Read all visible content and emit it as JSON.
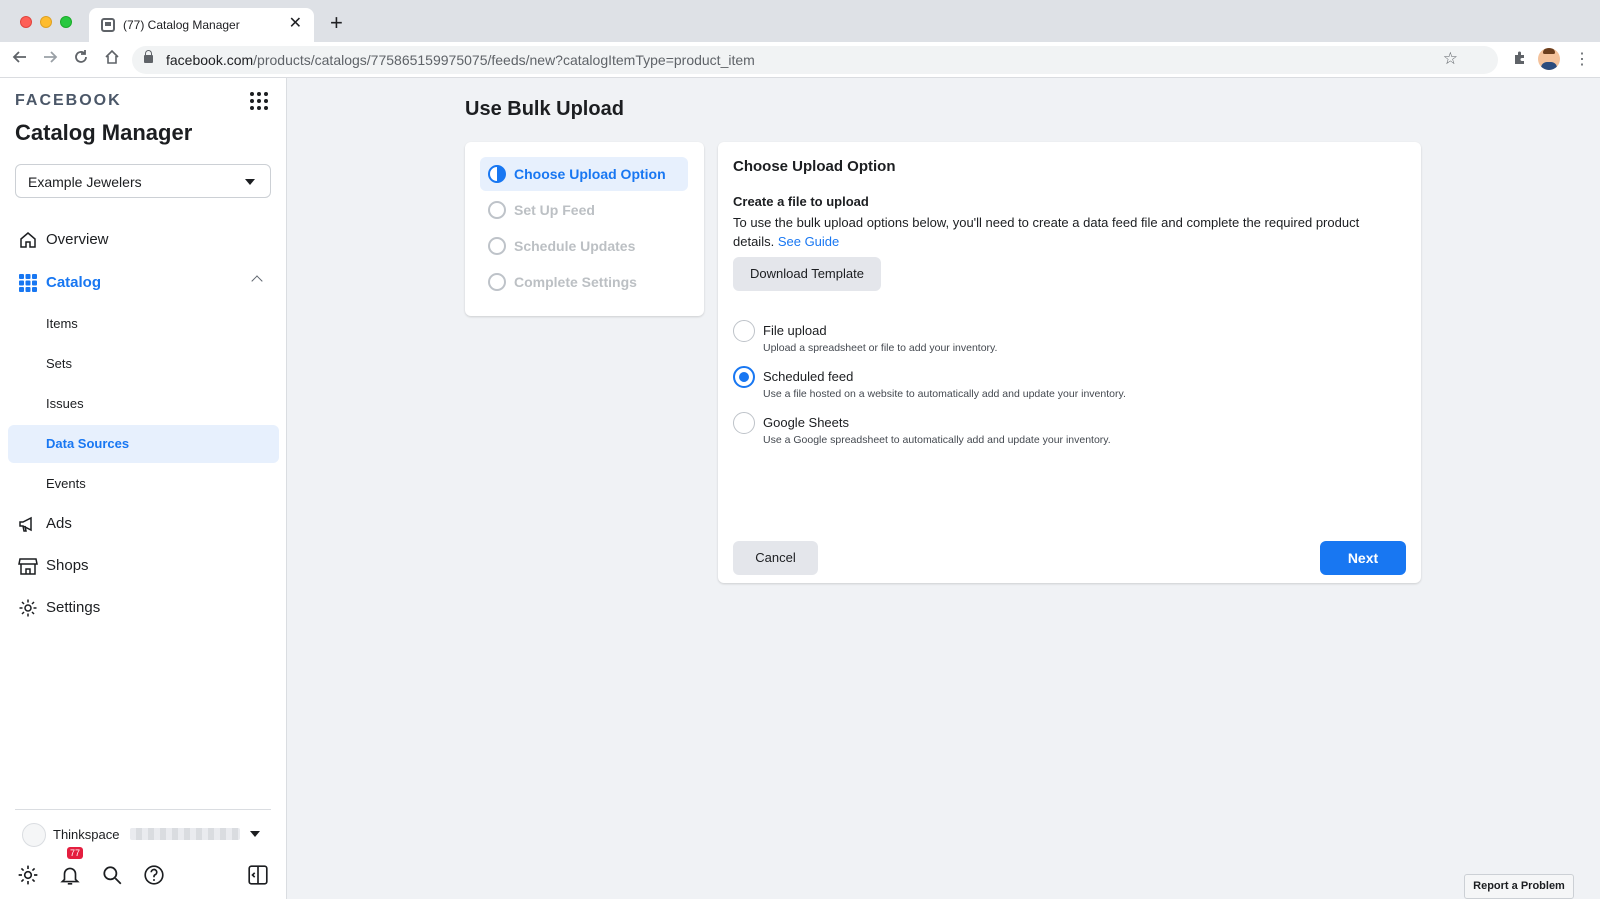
{
  "browser": {
    "tab_title": "(77) Catalog Manager",
    "tab_close": "✕",
    "new_tab": "+",
    "url_host": "facebook.com",
    "url_path": "/products/catalogs/775865159975075/feeds/new?catalogItemType=product_item",
    "icons": [
      "back-arrow-icon",
      "forward-arrow-icon",
      "reload-icon",
      "home-icon",
      "lock-icon",
      "star-icon",
      "extensions-icon",
      "profile-avatar-icon",
      "more-vert-icon"
    ]
  },
  "sidebar": {
    "brand": "FACEBOOK",
    "app_title": "Catalog Manager",
    "catalog_selector": "Example Jewelers",
    "nav": {
      "overview": "Overview",
      "catalog": "Catalog",
      "ads": "Ads",
      "shops": "Shops",
      "settings": "Settings"
    },
    "catalog_items": [
      "Items",
      "Sets",
      "Issues",
      "Data Sources",
      "Events"
    ],
    "selected_item": "Data Sources",
    "account_name": "Thinkspace",
    "notification_count": "77"
  },
  "main": {
    "page_title": "Use Bulk Upload",
    "steps": [
      "Choose Upload Option",
      "Set Up Feed",
      "Schedule Updates",
      "Complete Settings"
    ],
    "current_step": "Choose Upload Option",
    "card": {
      "title": "Choose Upload Option",
      "subtitle": "Create a file to upload",
      "description": "To use the bulk upload options below, you'll need to create a data feed file and complete the required product details.",
      "guide_link": "See Guide",
      "download_button": "Download Template",
      "options": [
        {
          "label": "File upload",
          "desc": "Upload a spreadsheet or file to add your inventory.",
          "checked": false
        },
        {
          "label": "Scheduled feed",
          "desc": "Use a file hosted on a website to automatically add and update your inventory.",
          "checked": true
        },
        {
          "label": "Google Sheets",
          "desc": "Use a Google spreadsheet to automatically add and update your inventory.",
          "checked": false
        }
      ],
      "cancel_button": "Cancel",
      "next_button": "Next"
    },
    "report_problem": "Report a Problem"
  },
  "colors": {
    "accent": "#1877f2",
    "selected_bg": "#e7f0fd",
    "page_bg": "#f0f2f5",
    "badge": "#e41e3f"
  }
}
